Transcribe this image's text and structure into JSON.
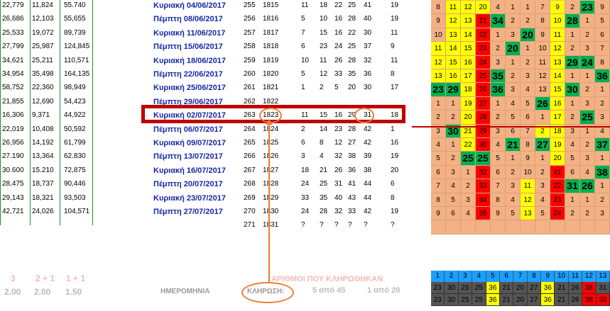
{
  "rows": [
    {
      "a": "22,779",
      "b": "11,824",
      "c": "55.740",
      "date": "Κυριακή 04/06/2017",
      "n1": "255",
      "n2": "1815",
      "d": [
        "11",
        "18",
        "22",
        "25",
        "41"
      ],
      "j": "19",
      "grid": [
        [
          "8",
          "o"
        ],
        [
          "11",
          "y"
        ],
        [
          "12",
          "y"
        ],
        [
          "20",
          "y"
        ],
        [
          "4",
          "o"
        ],
        [
          "1",
          "o"
        ],
        [
          "1",
          "o"
        ],
        [
          "7",
          "o"
        ],
        [
          "9",
          "y"
        ],
        [
          "2",
          "o"
        ],
        [
          "23",
          "g"
        ],
        [
          "9",
          "o"
        ]
      ]
    },
    {
      "a": "26,686",
      "b": "12,103",
      "c": "55,655",
      "date": "Πέμπτη 08/06/2017",
      "n1": "256",
      "n2": "1816",
      "d": [
        "5",
        "10",
        "16",
        "28",
        "40"
      ],
      "j": "19",
      "grid": [
        [
          "9",
          "o"
        ],
        [
          "12",
          "y"
        ],
        [
          "13",
          "y"
        ],
        [
          "21",
          "r"
        ],
        [
          "34",
          "g"
        ],
        [
          "2",
          "o"
        ],
        [
          "2",
          "o"
        ],
        [
          "8",
          "o"
        ],
        [
          "10",
          "y"
        ],
        [
          "28",
          "g"
        ],
        [
          "1",
          "o"
        ],
        [
          "5",
          "o"
        ]
      ]
    },
    {
      "a": "25,533",
      "b": "19,072",
      "c": "89,739",
      "date": "Κυριακή 11/06/2017",
      "n1": "257",
      "n2": "1817",
      "d": [
        "7",
        "15",
        "16",
        "22",
        "30"
      ],
      "j": "11",
      "grid": [
        [
          "10",
          "o"
        ],
        [
          "13",
          "y"
        ],
        [
          "14",
          "y"
        ],
        [
          "22",
          "r"
        ],
        [
          "1",
          "o"
        ],
        [
          "3",
          "o"
        ],
        [
          "20",
          "g"
        ],
        [
          "9",
          "o"
        ],
        [
          "11",
          "y"
        ],
        [
          "1",
          "o"
        ],
        [
          "2",
          "o"
        ],
        [
          "6",
          "o"
        ]
      ]
    },
    {
      "a": "27,799",
      "b": "25,987",
      "c": "124,845",
      "date": "Πέμπτη 15/06/2017",
      "n1": "258",
      "n2": "1818",
      "d": [
        "6",
        "23",
        "24",
        "25",
        "37"
      ],
      "j": "9",
      "grid": [
        [
          "11",
          "y"
        ],
        [
          "14",
          "y"
        ],
        [
          "15",
          "y"
        ],
        [
          "23",
          "r"
        ],
        [
          "2",
          "o"
        ],
        [
          "20",
          "g"
        ],
        [
          "1",
          "o"
        ],
        [
          "10",
          "o"
        ],
        [
          "12",
          "y"
        ],
        [
          "2",
          "o"
        ],
        [
          "3",
          "o"
        ],
        [
          "7",
          "o"
        ]
      ]
    },
    {
      "a": "34,621",
      "b": "25,211",
      "c": "110,571",
      "date": "Κυριακή 18/06/2017",
      "n1": "259",
      "n2": "1819",
      "d": [
        "10",
        "11",
        "26",
        "28",
        "32"
      ],
      "j": "11",
      "grid": [
        [
          "12",
          "y"
        ],
        [
          "15",
          "y"
        ],
        [
          "16",
          "y"
        ],
        [
          "24",
          "r"
        ],
        [
          "3",
          "o"
        ],
        [
          "1",
          "o"
        ],
        [
          "2",
          "o"
        ],
        [
          "11",
          "o"
        ],
        [
          "13",
          "y"
        ],
        [
          "29",
          "g"
        ],
        [
          "24",
          "g"
        ],
        [
          "8",
          "o"
        ]
      ]
    },
    {
      "a": "34,954",
      "b": "35,498",
      "c": "164,135",
      "date": "Πέμπτη 22/06/2017",
      "n1": "260",
      "n2": "1820",
      "d": [
        "5",
        "12",
        "33",
        "35",
        "36"
      ],
      "j": "8",
      "grid": [
        [
          "13",
          "y"
        ],
        [
          "16",
          "y"
        ],
        [
          "17",
          "y"
        ],
        [
          "25",
          "r"
        ],
        [
          "35",
          "g"
        ],
        [
          "2",
          "o"
        ],
        [
          "3",
          "o"
        ],
        [
          "12",
          "o"
        ],
        [
          "14",
          "y"
        ],
        [
          "1",
          "o"
        ],
        [
          "1",
          "o"
        ],
        [
          "36",
          "g"
        ]
      ]
    },
    {
      "a": "58,752",
      "b": "22,360",
      "c": "98,949",
      "date": "Κυριακή 25/06/2017",
      "n1": "261",
      "n2": "1821",
      "d": [
        "1",
        "2",
        "5",
        "20",
        "30"
      ],
      "j": "17",
      "grid": [
        [
          "23",
          "g"
        ],
        [
          "29",
          "g"
        ],
        [
          "18",
          "y"
        ],
        [
          "26",
          "r"
        ],
        [
          "36",
          "g"
        ],
        [
          "3",
          "o"
        ],
        [
          "4",
          "o"
        ],
        [
          "13",
          "o"
        ],
        [
          "15",
          "y"
        ],
        [
          "30",
          "g"
        ],
        [
          "2",
          "o"
        ],
        [
          "1",
          "o"
        ]
      ]
    },
    {
      "a": "21,855",
      "b": "12,690",
      "c": "54,423",
      "date": "Πέμπτη 29/06/2017",
      "n1": "262",
      "n2": "1822",
      "d": [
        "",
        "",
        "",
        "",
        "",
        ""
      ],
      "j": "",
      "grid": [
        [
          "1",
          "o"
        ],
        [
          "1",
          "o"
        ],
        [
          "19",
          "y"
        ],
        [
          "27",
          "r"
        ],
        [
          "1",
          "o"
        ],
        [
          "4",
          "o"
        ],
        [
          "5",
          "o"
        ],
        [
          "26",
          "g"
        ],
        [
          "16",
          "y"
        ],
        [
          "1",
          "o"
        ],
        [
          "3",
          "o"
        ],
        [
          "2",
          "o"
        ]
      ]
    },
    {
      "a": "16,306",
      "b": "9,371",
      "c": "44,922",
      "date": "Κυριακή 02/07/2017",
      "n1": "263",
      "n2": "1823",
      "d": [
        "11",
        "15",
        "16",
        "29",
        "31"
      ],
      "j": "18",
      "grid": [
        [
          "2",
          "o"
        ],
        [
          "2",
          "o"
        ],
        [
          "20",
          "y"
        ],
        [
          "28",
          "r"
        ],
        [
          "2",
          "o"
        ],
        [
          "5",
          "o"
        ],
        [
          "6",
          "o"
        ],
        [
          "1",
          "o"
        ],
        [
          "17",
          "y"
        ],
        [
          "2",
          "o"
        ],
        [
          "25",
          "g"
        ],
        [
          "3",
          "o"
        ]
      ]
    },
    {
      "a": "22,019",
      "b": "10,408",
      "c": "50,592",
      "date": "Πέμπτη 06/07/2017",
      "n1": "264",
      "n2": "1824",
      "d": [
        "2",
        "14",
        "23",
        "28",
        "42"
      ],
      "j": "1",
      "grid": [
        [
          "3",
          "o"
        ],
        [
          "30",
          "g"
        ],
        [
          "21",
          "y"
        ],
        [
          "29",
          "r"
        ],
        [
          "3",
          "o"
        ],
        [
          "6",
          "o"
        ],
        [
          "7",
          "o"
        ],
        [
          "2",
          "y"
        ],
        [
          "18",
          "y"
        ],
        [
          "3",
          "o"
        ],
        [
          "1",
          "o"
        ],
        [
          "4",
          "o"
        ]
      ]
    },
    {
      "a": "26,956",
      "b": "14,192",
      "c": "61,799",
      "date": "Κυριακή 09/07/2017",
      "n1": "265",
      "n2": "1825",
      "d": [
        "6",
        "8",
        "12",
        "27",
        "42"
      ],
      "j": "16",
      "grid": [
        [
          "4",
          "o"
        ],
        [
          "1",
          "o"
        ],
        [
          "22",
          "y"
        ],
        [
          "30",
          "r"
        ],
        [
          "4",
          "o"
        ],
        [
          "21",
          "g"
        ],
        [
          "8",
          "o"
        ],
        [
          "27",
          "g"
        ],
        [
          "19",
          "y"
        ],
        [
          "4",
          "o"
        ],
        [
          "2",
          "o"
        ],
        [
          "37",
          "g"
        ]
      ]
    },
    {
      "a": "27.190",
      "b": "13,364",
      "c": "62.830",
      "date": "Πέμπτη 13/07/2017",
      "n1": "266",
      "n2": "1826",
      "d": [
        "3",
        "4",
        "32",
        "38",
        "39"
      ],
      "j": "19",
      "grid": [
        [
          "5",
          "o"
        ],
        [
          "2",
          "o"
        ],
        [
          "25",
          "g"
        ],
        [
          "25",
          "g"
        ],
        [
          "5",
          "o"
        ],
        [
          "1",
          "o"
        ],
        [
          "9",
          "o"
        ],
        [
          "1",
          "o"
        ],
        [
          "20",
          "y"
        ],
        [
          "5",
          "o"
        ],
        [
          "3",
          "o"
        ],
        [
          "1",
          "o"
        ]
      ]
    },
    {
      "a": "30.600",
      "b": "15.210",
      "c": "72,875",
      "date": "Κυριακή 16/07/2017",
      "n1": "267",
      "n2": "1827",
      "d": [
        "18",
        "21",
        "26",
        "36",
        "38"
      ],
      "j": "20",
      "grid": [
        [
          "6",
          "o"
        ],
        [
          "3",
          "o"
        ],
        [
          "1",
          "o"
        ],
        [
          "32",
          "r"
        ],
        [
          "6",
          "o"
        ],
        [
          "2",
          "o"
        ],
        [
          "10",
          "o"
        ],
        [
          "2",
          "o"
        ],
        [
          "21",
          "r"
        ],
        [
          "6",
          "o"
        ],
        [
          "4",
          "o"
        ],
        [
          "38",
          "g"
        ]
      ]
    },
    {
      "a": "28,475",
      "b": "18,737",
      "c": "90,446",
      "date": "Πέμπτη 20/07/2017",
      "n1": "268",
      "n2": "1828",
      "d": [
        "24",
        "25",
        "31",
        "41",
        "44"
      ],
      "j": "6",
      "grid": [
        [
          "7",
          "o"
        ],
        [
          "4",
          "o"
        ],
        [
          "2",
          "o"
        ],
        [
          "33",
          "r"
        ],
        [
          "7",
          "o"
        ],
        [
          "3",
          "o"
        ],
        [
          "11",
          "y"
        ],
        [
          "3",
          "o"
        ],
        [
          "22",
          "r"
        ],
        [
          "31",
          "g"
        ],
        [
          "26",
          "g"
        ],
        [
          "1",
          "o"
        ]
      ]
    },
    {
      "a": "29,143",
      "b": "18,321",
      "c": "93,503",
      "date": "Κυριακή 23/07/2017",
      "n1": "269",
      "n2": "1829",
      "d": [
        "33",
        "35",
        "40",
        "43",
        "44"
      ],
      "j": "8",
      "grid": [
        [
          "8",
          "o"
        ],
        [
          "5",
          "o"
        ],
        [
          "3",
          "o"
        ],
        [
          "34",
          "r"
        ],
        [
          "8",
          "o"
        ],
        [
          "4",
          "o"
        ],
        [
          "12",
          "y"
        ],
        [
          "4",
          "o"
        ],
        [
          "23",
          "r"
        ],
        [
          "1",
          "o"
        ],
        [
          "1",
          "o"
        ],
        [
          "2",
          "o"
        ]
      ]
    },
    {
      "a": "42,721",
      "b": "24,026",
      "c": "104,571",
      "date": "Πέμπτη 27/07/2017",
      "n1": "270",
      "n2": "1830",
      "d": [
        "24",
        "28",
        "32",
        "33",
        "42"
      ],
      "j": "19",
      "grid": [
        [
          "9",
          "o"
        ],
        [
          "6",
          "o"
        ],
        [
          "4",
          "o"
        ],
        [
          "35",
          "r"
        ],
        [
          "9",
          "o"
        ],
        [
          "5",
          "o"
        ],
        [
          "13",
          "y"
        ],
        [
          "5",
          "o"
        ],
        [
          "24",
          "r"
        ],
        [
          "2",
          "o"
        ],
        [
          "2",
          "o"
        ],
        [
          "3",
          "o"
        ]
      ]
    },
    {
      "a": "",
      "b": "",
      "c": "",
      "date": "",
      "n1": "271",
      "n2": "1831",
      "d": [
        "?",
        "?",
        "?",
        "?",
        "?"
      ],
      "j": "?",
      "grid": [
        [
          "",
          "o"
        ],
        [
          "",
          "o"
        ],
        [
          "",
          "o"
        ],
        [
          "",
          "o"
        ],
        [
          "",
          "o"
        ],
        [
          "",
          "o"
        ],
        [
          "",
          "o"
        ],
        [
          "",
          "o"
        ],
        [
          "",
          "o"
        ],
        [
          "",
          "o"
        ],
        [
          "",
          "o"
        ],
        [
          "",
          "o"
        ]
      ]
    }
  ],
  "footer": {
    "hits_3": "3",
    "hits_2_1": "2 + 1",
    "hits_1_1": "1 + 1",
    "odds_3": "2.00",
    "odds_2_1": "2.00",
    "odds_1_1": "1.50",
    "date_header": "ΗΜΕΡΟΜΗΝΙΑ",
    "draw_header": "ΚΛΗΡΩΣΗ:",
    "winning_numbers_title": "ΑΡΙΘΜΟΙ ΠΟΥ ΚΛΗΡΩΘΗΚΑΝ",
    "five_of_45": "5 από 45",
    "one_of_20": "1 από 20"
  },
  "bottom_header": [
    "1",
    "2",
    "3",
    "4",
    "5",
    "6",
    "7",
    "8",
    "9",
    "10",
    "11",
    "12",
    "13"
  ],
  "bottom_row1": [
    "23",
    "30",
    "25",
    "25",
    "36",
    "21",
    "20",
    "27",
    "36",
    "21",
    "26",
    "38",
    "31"
  ],
  "bottom_row2": [
    "23",
    "30",
    "25",
    "25",
    "36",
    "21",
    "20",
    "27",
    "36",
    "21",
    "26",
    "38",
    "38"
  ],
  "colors": {
    "orange": "#f4b183",
    "yellow": "#ffff00",
    "red": "#ff0000",
    "green": "#00b050",
    "blue_text": "#1528a8",
    "highlight": "#c00000",
    "annotation": "#ed7d31"
  }
}
